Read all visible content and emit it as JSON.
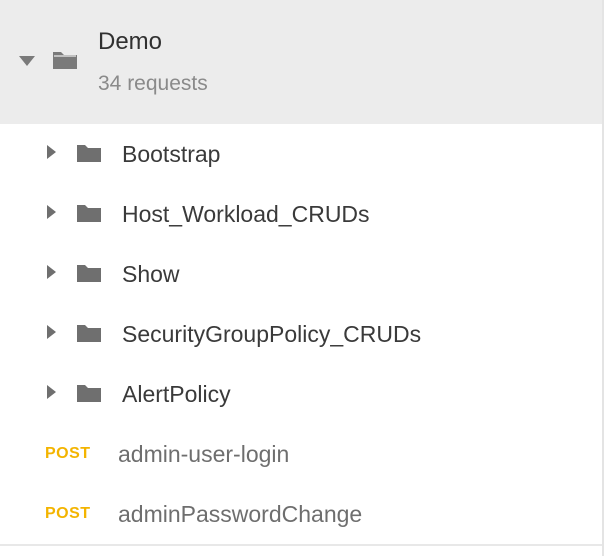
{
  "collection": {
    "name": "Demo",
    "count_label": "34 requests",
    "expanded": true
  },
  "folders": [
    {
      "label": "Bootstrap"
    },
    {
      "label": "Host_Workload_CRUDs"
    },
    {
      "label": "Show"
    },
    {
      "label": "SecurityGroupPolicy_CRUDs"
    },
    {
      "label": "AlertPolicy"
    }
  ],
  "requests": [
    {
      "method": "POST",
      "label": "admin-user-login"
    },
    {
      "method": "POST",
      "label": "adminPasswordChange"
    }
  ],
  "colors": {
    "header_bg": "#ececec",
    "post_method": "#f3b400",
    "folder_icon": "#7a7a7a"
  },
  "icons": {
    "collection_toggle": "caret-down-icon",
    "collection_folder": "folder-icon",
    "folder_toggle": "caret-right-icon",
    "folder": "folder-icon"
  }
}
